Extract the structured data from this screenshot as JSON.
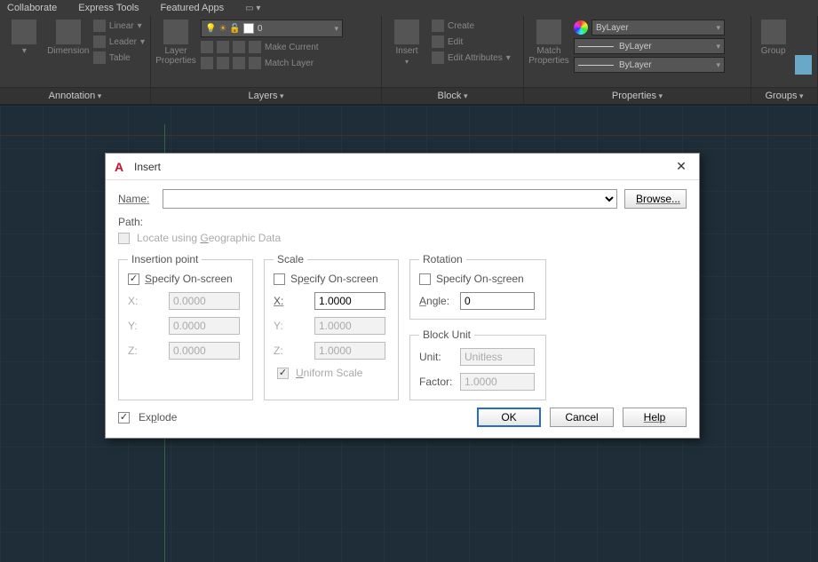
{
  "menubar": {
    "items": [
      "Collaborate",
      "Express Tools",
      "Featured Apps"
    ]
  },
  "ribbon": {
    "annotation": {
      "title": "Annotation",
      "dimension": "Dimension",
      "sub": [
        "Linear",
        "Leader",
        "Table"
      ]
    },
    "layers": {
      "title": "Layers",
      "properties_btn": "Layer\nProperties",
      "combo_value": "0",
      "row2": "Make Current",
      "row3": "Match Layer"
    },
    "block": {
      "title": "Block",
      "insert_btn": "Insert",
      "rows": [
        "Create",
        "Edit",
        "Edit Attributes"
      ]
    },
    "properties": {
      "title": "Properties",
      "match_btn": "Match\nProperties",
      "combo1": "ByLayer",
      "combo2": "ByLayer",
      "combo3": "ByLayer"
    },
    "groups": {
      "title": "Groups",
      "group_btn": "Group"
    }
  },
  "dialog": {
    "title": "Insert",
    "name_label": "Name:",
    "name_value": "",
    "browse": "Browse...",
    "path_label": "Path:",
    "locate_geo": "Locate using Geographic Data",
    "insertionPoint": {
      "legend": "Insertion point",
      "specify": "Specify On-screen",
      "x_label": "X:",
      "x": "0.0000",
      "y_label": "Y:",
      "y": "0.0000",
      "z_label": "Z:",
      "z": "0.0000"
    },
    "scale": {
      "legend": "Scale",
      "specify": "Specify On-screen",
      "x_label": "X:",
      "x": "1.0000",
      "y_label": "Y:",
      "y": "1.0000",
      "z_label": "Z:",
      "z": "1.0000",
      "uniform": "Uniform Scale"
    },
    "rotation": {
      "legend": "Rotation",
      "specify": "Specify On-screen",
      "angle_label": "Angle:",
      "angle": "0"
    },
    "blockUnit": {
      "legend": "Block Unit",
      "unit_label": "Unit:",
      "unit": "Unitless",
      "factor_label": "Factor:",
      "factor": "1.0000"
    },
    "explode": "Explode",
    "ok": "OK",
    "cancel": "Cancel",
    "help": "Help"
  }
}
